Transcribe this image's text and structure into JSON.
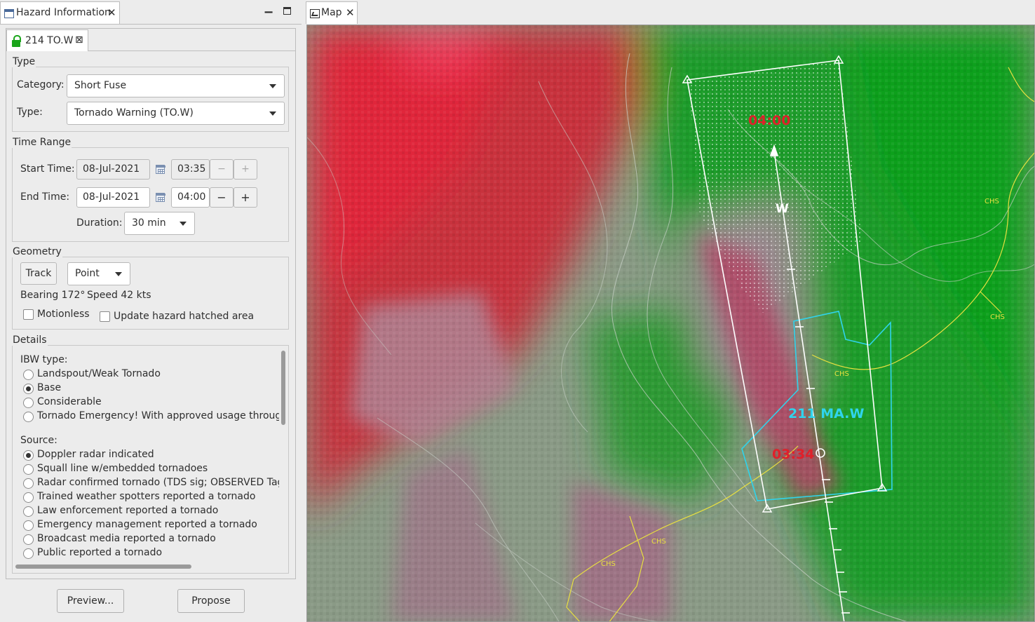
{
  "left_view": {
    "tab_label": "Hazard Information",
    "close_glyph": "✕",
    "minimize_glyph": "▁",
    "icon": "view-icon"
  },
  "hazard_tab": {
    "label": "214 TO.W",
    "icon": "unlocked-lock-icon",
    "close_glyph": "⊠",
    "lock_color": "#1aa51a"
  },
  "type_group": {
    "title": "Type",
    "category_label": "Category:",
    "category_value": "Short Fuse",
    "type_label": "Type:",
    "type_value": "Tornado Warning (TO.W)"
  },
  "time_range": {
    "title": "Time Range",
    "start_label": "Start Time:",
    "start_date": "08-Jul-2021",
    "start_time": "03:35",
    "end_label": "End Time:",
    "end_date": "08-Jul-2021",
    "end_time": "04:00",
    "minus": "−",
    "plus": "+",
    "duration_label": "Duration:",
    "duration_value": "30 min"
  },
  "geometry": {
    "title": "Geometry",
    "track_button": "Track",
    "mode_value": "Point",
    "bearing": "Bearing 172°",
    "speed": "Speed 42 kts",
    "motionless_label": "Motionless",
    "update_hatched_label": "Update hazard hatched area"
  },
  "details": {
    "title": "Details",
    "ibw_title": "IBW type:",
    "ibw_options": [
      {
        "label": "Landspout/Weak Tornado",
        "selected": false
      },
      {
        "label": "Base",
        "selected": true
      },
      {
        "label": "Considerable",
        "selected": false
      },
      {
        "label": "Tornado Emergency! With approved usage through shi",
        "selected": false
      }
    ],
    "source_title": "Source:",
    "source_options": [
      {
        "label": "Doppler radar indicated",
        "selected": true
      },
      {
        "label": "Squall line w/embedded tornadoes",
        "selected": false
      },
      {
        "label": "Radar confirmed tornado (TDS sig; OBSERVED Tag)",
        "selected": false
      },
      {
        "label": "Trained weather spotters reported a tornado",
        "selected": false
      },
      {
        "label": "Law enforcement reported a tornado",
        "selected": false
      },
      {
        "label": "Emergency management reported a tornado",
        "selected": false
      },
      {
        "label": "Broadcast media reported a tornado",
        "selected": false
      },
      {
        "label": "Public reported a tornado",
        "selected": false
      }
    ]
  },
  "footer": {
    "preview_label": "Preview...",
    "propose_label": "Propose"
  },
  "map_view": {
    "tab_label": "Map",
    "close_glyph": "✕",
    "icon": "map-icon",
    "labels": {
      "end_time": "04:00",
      "storm_time": "03:34",
      "direction": "W",
      "other_hazard": "211 MA.W",
      "county_labels": [
        "CHS",
        "CHS",
        "CHS",
        "CHS",
        "CHS"
      ]
    },
    "colors": {
      "outbound_velocity": "#c0303c",
      "inbound_velocity": "#1e9a2a",
      "neutral": "#8a9a82",
      "hazard_outline": "#ffffff",
      "other_hazard_outline": "#2fd4ec",
      "time_label": "#e0202a",
      "county_line": "#e8e040"
    }
  }
}
